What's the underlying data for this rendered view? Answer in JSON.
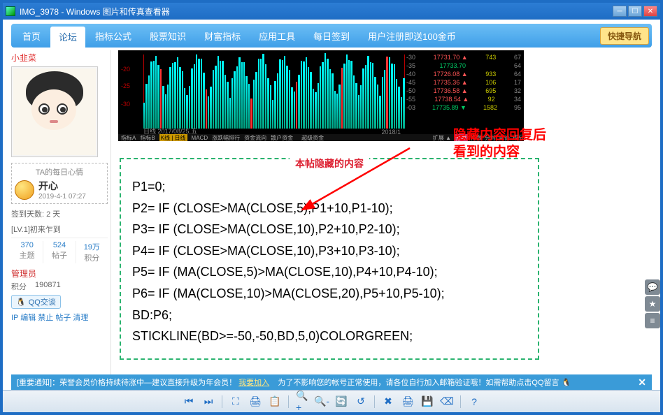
{
  "window": {
    "title": "IMG_3978 - Windows 图片和传真查看器"
  },
  "nav": {
    "items": [
      "首页",
      "论坛",
      "指标公式",
      "股票知识",
      "财富指标",
      "应用工具",
      "每日签到",
      "用户注册即送100金币"
    ],
    "active": 1,
    "quicknav": "快捷导航"
  },
  "user": {
    "nickname": "小韭菜",
    "mood": {
      "box_label": "TA的每日心情",
      "name": "开心",
      "date": "2019-4-1",
      "time": "07:27"
    },
    "signin": "签到天数: 2 天",
    "level": "[LV.1]初来乍到",
    "stats": [
      {
        "num": "370",
        "lbl": "主题"
      },
      {
        "num": "524",
        "lbl": "帖子"
      },
      {
        "num": "19万",
        "lbl": "积分"
      }
    ],
    "role": "管理员",
    "points": {
      "jifen": "积分",
      "jifen_val": "190871"
    },
    "qq": "QQ交谈",
    "ipline": "IP 编辑 禁止 帖子 清理"
  },
  "chart": {
    "ylabels": [
      "-20",
      "-25",
      "-30"
    ],
    "date_start": "日线  2017/08/25,五",
    "date_end": "2018/1",
    "right_rows": [
      [
        "-30",
        "17731.70 ▲",
        "743",
        "67"
      ],
      [
        "-35",
        "17733.70",
        "",
        "64"
      ],
      [
        "-40",
        "17726.08 ▲",
        "933",
        "64"
      ],
      [
        "-45",
        "17735.36 ▲",
        "106",
        "17"
      ],
      [
        "-50",
        "17736.58 ▲",
        "695",
        "32"
      ],
      [
        "-55",
        "17738.54 ▲",
        "92",
        "34"
      ],
      [
        "-03",
        "17735.89 ▼",
        "1582",
        "95"
      ]
    ],
    "bottom_tabs": [
      "指标A",
      "指标B",
      "K线 | 日线",
      "MACD",
      "涨跌幅排行",
      "资金流向",
      "散户资金",
      "",
      "超级资金"
    ],
    "bottom_right": [
      "扩展 ▲",
      "分章",
      "指数",
      "分时",
      "竞价",
      "成分"
    ]
  },
  "post": {
    "hidden_label": "本帖隐藏的内容",
    "annotation": "隐藏内容回复后\n看到的内容",
    "code": [
      "P1=0;",
      "P2= IF (CLOSE>MA(CLOSE,5),P1+10,P1-10);",
      "P3= IF (CLOSE>MA(CLOSE,10),P2+10,P2-10);",
      "P4= IF (CLOSE>MA(CLOSE,10),P3+10,P3-10);",
      "P5= IF (MA(CLOSE,5)>MA(CLOSE,10),P4+10,P4-10);",
      "P6= IF (MA(CLOSE,10)>MA(CLOSE,20),P5+10,P5-10);",
      "BD:P6;",
      "STICKLINE(BD>=-50,-50,BD,5,0)COLORGREEN;"
    ]
  },
  "notice": {
    "left": "[重要通知]：荣誉会员价格持续待涨中—建议直接升级为年会员！",
    "join": "我要加入",
    "right": "为了不影响您的帐号正常使用，请各位自行加入邮箱验证哦！如需帮助点击QQ留言"
  },
  "toolbar_icons": [
    "⏮",
    "⏭",
    "⛶",
    "🖨",
    "📋",
    "🔍+",
    "🔍-",
    "🔄",
    "↺",
    "✖",
    "🖨",
    "💾",
    "⌫",
    "?"
  ]
}
